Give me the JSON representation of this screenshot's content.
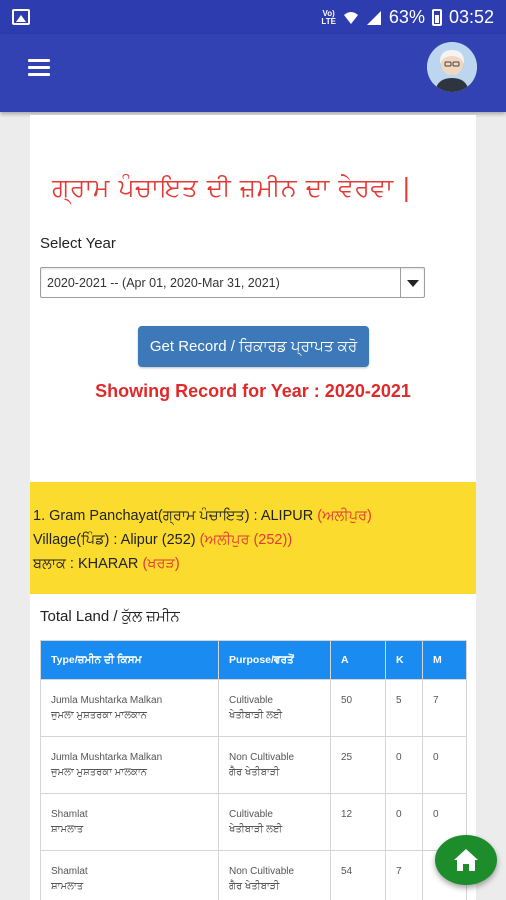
{
  "status_bar": {
    "volte": "VoLTE",
    "battery": "63%",
    "time": "03:52"
  },
  "header": {
    "menu_icon": "hamburger-menu-icon",
    "avatar_icon": "user-avatar-icon"
  },
  "page": {
    "title": "ਗ੍ਰਾਮ ਪੰਚਾਇਤ ਦੀ ਜ਼ਮੀਨ ਦਾ ਵੇਰਵਾ |",
    "select_label": "Select Year",
    "year_selected": "2020-2021 -- (Apr 01, 2020-Mar 31, 2021)",
    "get_button": "Get Record / ਰਿਕਾਰਡ ਪ੍ਰਾਪਤ ਕਰੋ",
    "showing_record": "Showing Record for Year : 2020-2021"
  },
  "gram_panchayat": {
    "line1": "1. Gram Panchayat(ਗ੍ਰਾਮ ਪੰਚਾਇਤ) : ALIPUR ",
    "line1_red": "(ਅਲੀਪੁਰ)",
    "line2": "Village(ਪਿੰਡ) : Alipur (252) ",
    "line2_red": "(ਅਲੀਪੁਰ (252))",
    "line3": "ਬਲਾਕ : KHARAR ",
    "line3_red": "(ਖਰੜ)"
  },
  "total_land": {
    "heading": "Total Land / ਕੁੱਲ ਜ਼ਮੀਨ",
    "columns": [
      "Type/ਜ਼ਮੀਨ ਦੀ ਕਿਸਮ",
      "Purpose/ਵਰਤੋਂ",
      "A",
      "K",
      "M"
    ],
    "rows": [
      {
        "type": "Jumla Mushtarka Malkan",
        "type_pa": "ਜੁਮਲਾ ਮੁਸ਼ਤਰਕਾ ਮਾਲਕਾਨ",
        "purpose": "Cultivable",
        "purpose_pa": "ਖੇਤੀਬਾੜੀ ਲਈ",
        "a": "50",
        "k": "5",
        "m": "7"
      },
      {
        "type": "Jumla Mushtarka Malkan",
        "type_pa": "ਜੁਮਲਾ ਮੁਸ਼ਤਰਕਾ ਮਾਲਕਾਨ",
        "purpose": "Non Cultivable",
        "purpose_pa": "ਗੈਰ ਖੇਤੀਬਾੜੀ",
        "a": "25",
        "k": "0",
        "m": "0"
      },
      {
        "type": "Shamlat",
        "type_pa": "ਸ਼ਾਮਲਾਤ",
        "purpose": "Cultivable",
        "purpose_pa": "ਖੇਤੀਬਾੜੀ ਲਈ",
        "a": "12",
        "k": "0",
        "m": "0"
      },
      {
        "type": "Shamlat",
        "type_pa": "ਸ਼ਾਮਲਾਤ",
        "purpose": "Non Cultivable",
        "purpose_pa": "ਗੈਰ ਖੇਤੀਬਾੜੀ",
        "a": "54",
        "k": "7",
        "m": ""
      }
    ]
  },
  "fab": {
    "icon": "home-icon"
  },
  "colors": {
    "app_bar": "#3342b3",
    "title_red": "#e53935",
    "button_blue": "#3d79b8",
    "table_header": "#1a8bf0",
    "highlight_yellow": "#fbdc2e",
    "fab_green": "#1d8c2a"
  }
}
